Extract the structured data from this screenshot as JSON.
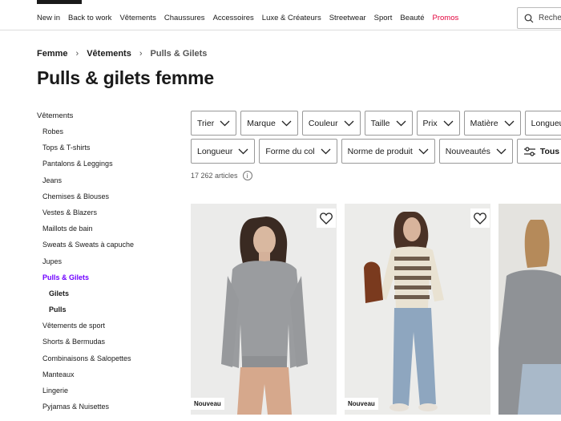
{
  "nav": {
    "items": [
      "New in",
      "Back to work",
      "Vêtements",
      "Chaussures",
      "Accessoires",
      "Luxe & Créateurs",
      "Streetwear",
      "Sport",
      "Beauté"
    ],
    "promo": "Promos",
    "search_placeholder": "Reche"
  },
  "breadcrumb": [
    "Femme",
    "Vêtements",
    "Pulls & Gilets"
  ],
  "page_title": "Pulls & gilets femme",
  "sidebar": {
    "root": "Vêtements",
    "items": [
      {
        "label": "Robes"
      },
      {
        "label": "Tops & T-shirts"
      },
      {
        "label": "Pantalons & Leggings"
      },
      {
        "label": "Jeans"
      },
      {
        "label": "Chemises & Blouses"
      },
      {
        "label": "Vestes & Blazers"
      },
      {
        "label": "Maillots de bain"
      },
      {
        "label": "Sweats & Sweats à capuche"
      },
      {
        "label": "Jupes"
      },
      {
        "label": "Pulls & Gilets",
        "state": "active"
      },
      {
        "label": "Gilets",
        "state": "sub"
      },
      {
        "label": "Pulls",
        "state": "sub"
      },
      {
        "label": "Vêtements de sport"
      },
      {
        "label": "Shorts & Bermudas"
      },
      {
        "label": "Combinaisons & Salopettes"
      },
      {
        "label": "Manteaux"
      },
      {
        "label": "Lingerie"
      },
      {
        "label": "Pyjamas & Nuisettes"
      }
    ]
  },
  "filters": {
    "row1": [
      "Trier",
      "Marque",
      "Couleur",
      "Taille",
      "Prix",
      "Matière",
      "Longueur"
    ],
    "row2": [
      "Longueur",
      "Forme du col",
      "Norme de produit",
      "Nouveautés"
    ],
    "all_label": "Tous le"
  },
  "count": "17 262 articles",
  "products": [
    {
      "badge": "Nouveau",
      "description": "woman in grey crew-neck jumper and beige trousers"
    },
    {
      "badge": "Nouveau",
      "description": "woman in striped brown and cream jumper with jeans"
    },
    {
      "badge": "",
      "description": "woman in grey cardigan, partially visible"
    }
  ],
  "colors": {
    "accent": "#6f00ff",
    "promo": "#e2003b"
  }
}
